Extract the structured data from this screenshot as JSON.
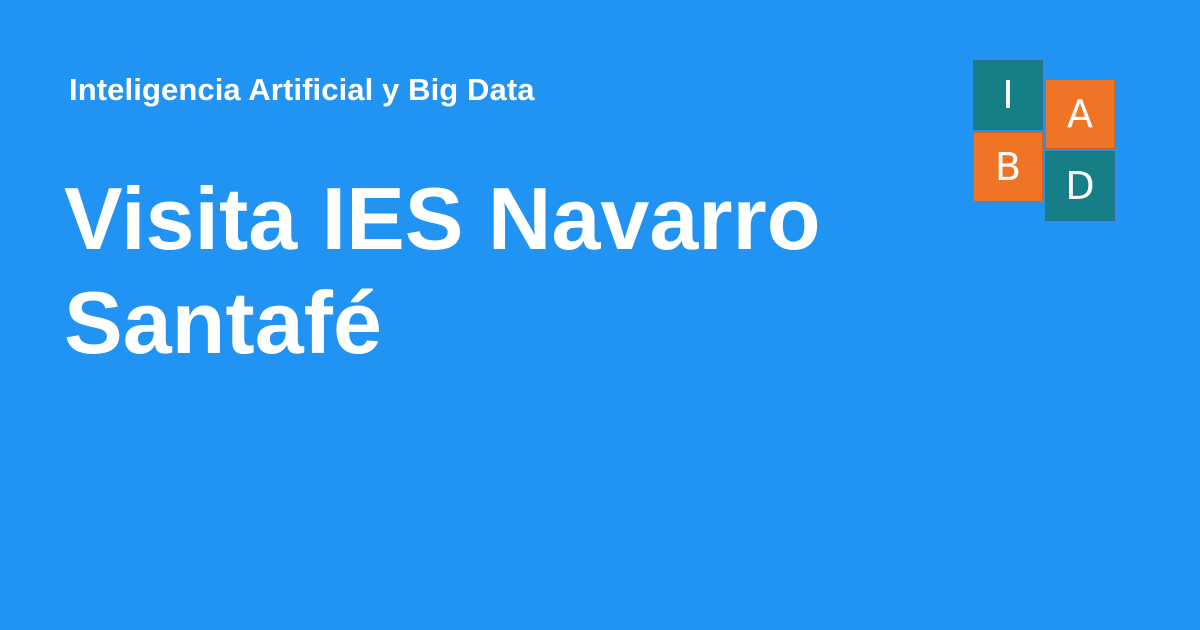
{
  "header": {
    "site_name": "Inteligencia Artificial y Big Data"
  },
  "main": {
    "title": "Visita IES Navarro Santafé"
  },
  "logo": {
    "tiles": [
      "I",
      "A",
      "B",
      "D"
    ],
    "colors": {
      "teal": "#167E86",
      "orange": "#F07425"
    }
  },
  "theme": {
    "background": "#2193F2",
    "text": "#FFFFFF"
  }
}
